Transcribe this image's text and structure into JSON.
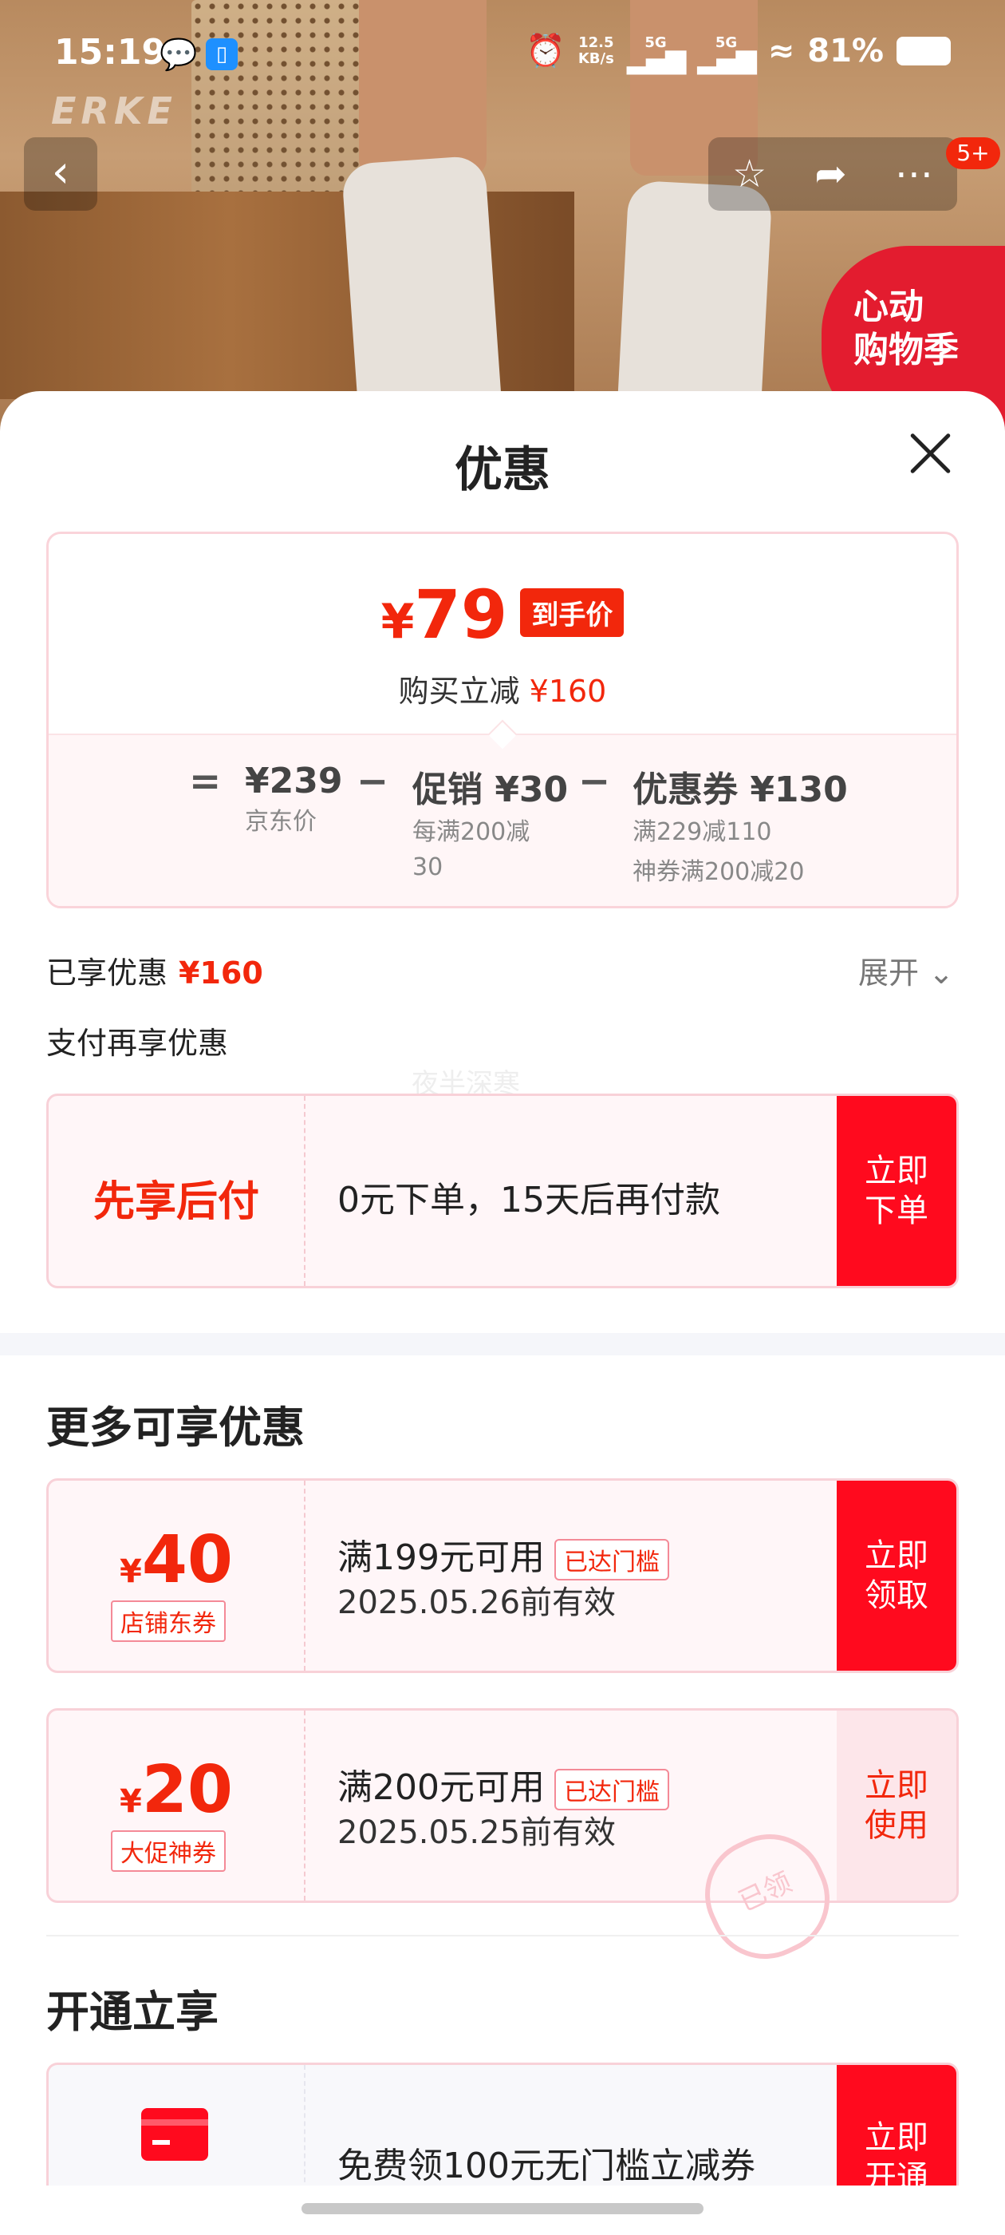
{
  "status_bar": {
    "time": "15:19",
    "speed_top": "12.5",
    "speed_bottom": "KB/s",
    "net1": "5G",
    "net2": "5G",
    "battery": "81%"
  },
  "background": {
    "brand": "ERKE",
    "promo_line1": "心动",
    "promo_line2": "购物季"
  },
  "nav": {
    "badge": "5+"
  },
  "sheet": {
    "title": "优惠"
  },
  "price_summary": {
    "currency": "¥",
    "final_price": "79",
    "final_tag": "到手价",
    "reduce_label": "购买立减",
    "reduce_value": "¥160",
    "equals": "=",
    "minus": "−",
    "jd_price": "¥239",
    "jd_label": "京东价",
    "promo_main": "促销 ¥30",
    "promo_sub1": "每满200减",
    "promo_sub2": "30",
    "coupon_main": "优惠券 ¥130",
    "coupon_sub1": "满229减110",
    "coupon_sub2": "神券满200减20"
  },
  "enjoyed": {
    "label": "已享优惠",
    "value": "¥160",
    "expand": "展开"
  },
  "pay_more": {
    "label": "支付再享优惠",
    "watermark": "夜半深寒"
  },
  "bnpl": {
    "title": "先享后付",
    "desc": "0元下单，15天后再付款",
    "action": "立即\n下单"
  },
  "more_offers": {
    "title": "更多可享优惠",
    "coupons": [
      {
        "yen": "¥",
        "amount": "40",
        "tag": "店铺东券",
        "condition": "满199元可用",
        "status": "已达门槛",
        "valid": "2025.05.26前有效",
        "action": "立即\n领取"
      },
      {
        "yen": "¥",
        "amount": "20",
        "tag": "大促神券",
        "condition": "满200元可用",
        "status": "已达门槛",
        "valid": "2025.05.25前有效",
        "action": "立即\n使用",
        "stamp": "已领"
      }
    ]
  },
  "open_enjoy": {
    "title": "开通立享",
    "desc": "免费领100元无门槛立减券",
    "action": "立即\n开通"
  },
  "colors": {
    "accent": "#f2270c",
    "action_red": "#ff0a1e"
  }
}
